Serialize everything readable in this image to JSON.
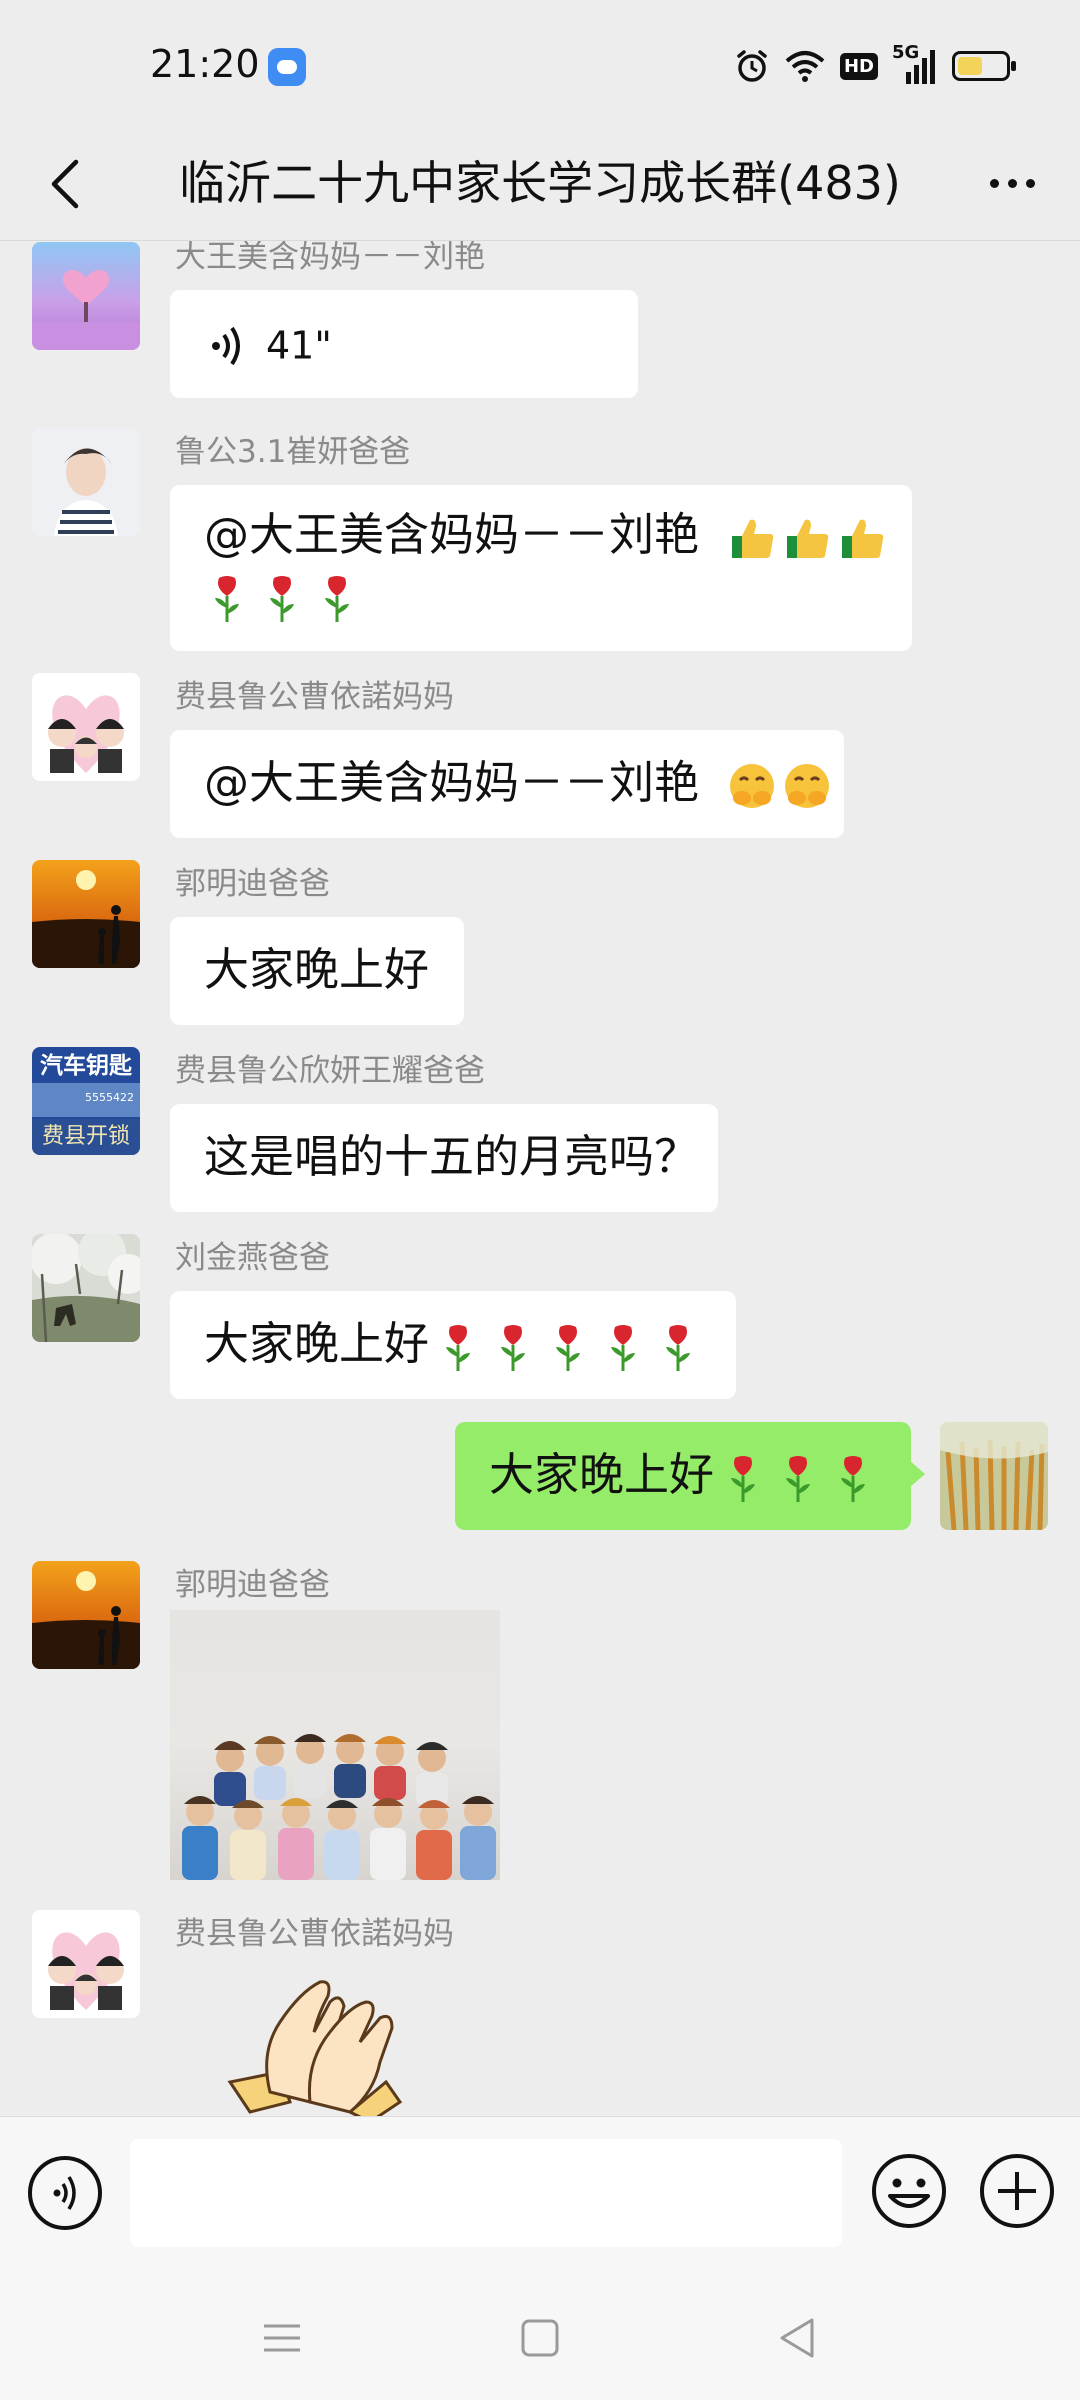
{
  "status_bar": {
    "time": "21:20",
    "hd_label": "HD",
    "network_label": "5G"
  },
  "header": {
    "title": "临沂二十九中家长学习成长群(483)"
  },
  "messages": [
    {
      "sender": "大王美含妈妈－－刘艳",
      "type": "voice",
      "duration": "41\""
    },
    {
      "sender": "鲁公3.1崔妍爸爸",
      "type": "text",
      "text_line1": "@大王美含妈妈－－刘艳",
      "emojis_line1": [
        "thumbs-up",
        "thumbs-up",
        "thumbs-up"
      ],
      "emojis_line2": [
        "rose",
        "rose",
        "rose"
      ]
    },
    {
      "sender": "费县鲁公曹依諾妈妈",
      "type": "text",
      "text": "@大王美含妈妈－－刘艳",
      "emojis": [
        "shy-face",
        "shy-face"
      ]
    },
    {
      "sender": "郭明迪爸爸",
      "type": "text",
      "text": "大家晚上好"
    },
    {
      "sender": "费县鲁公欣妍王耀爸爸",
      "type": "text",
      "text": "这是唱的十五的月亮吗？",
      "avatar_text_top": "汽车钥匙",
      "avatar_text_bottom": "费县开锁",
      "avatar_phone": "5555422"
    },
    {
      "sender": "刘金燕爸爸",
      "type": "text",
      "text": "大家晚上好",
      "emojis": [
        "rose",
        "rose",
        "rose",
        "rose",
        "rose"
      ]
    },
    {
      "sender": "me",
      "type": "text",
      "text": "大家晚上好",
      "emojis": [
        "rose",
        "rose",
        "rose"
      ]
    },
    {
      "sender": "郭明迪爸爸",
      "type": "image",
      "image_desc": "group-photo"
    },
    {
      "sender": "费县鲁公曹依諾妈妈",
      "type": "sticker",
      "sticker": "clapping-hands"
    }
  ],
  "input": {
    "value": "",
    "placeholder": ""
  },
  "colors": {
    "background": "#ededed",
    "bubble_self": "#95ec69",
    "bubble_other": "#ffffff",
    "rose": "#d9262e"
  }
}
